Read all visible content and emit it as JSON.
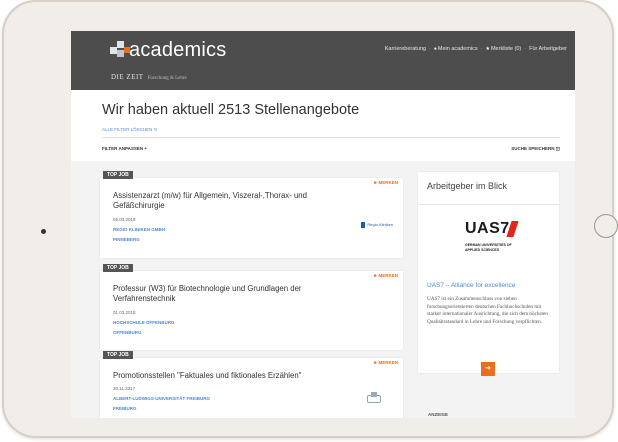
{
  "header": {
    "logo_text": "academics",
    "logo_sub_brand": "DIE ZEIT",
    "logo_sub_tagline": "Forschung & Lehre",
    "nav": {
      "karriereberatung": "Karriereberatung",
      "mein_academics": "Mein academics",
      "merkliste": "Merkliste (0)",
      "arbeitgeber": "Für Arbeitgeber"
    }
  },
  "page": {
    "title": "Wir haben aktuell 2513 Stellenangebote",
    "clear_filters": "ALLE FILTER LÖSCHEN",
    "adjust_filters": "FILTER ANPASSEN +",
    "save_search": "SUCHE SPEICHERN"
  },
  "jobs": [
    {
      "badge": "TOP JOB",
      "merken": "MERKEN",
      "title": "Assistenzarzt (m/w) für Allgemein, Viszeral-,Thorax- und Gefäßchirurgie",
      "date": "05.03.2018",
      "employer": "REGIO KLINIKEN GMBH",
      "city": "PINNEBERG",
      "logo_text": "Regio Kliniken"
    },
    {
      "badge": "TOP JOB",
      "merken": "MERKEN",
      "title": "Professur (W3) für Biotechnologie und Grundlagen der Verfahrenstechnik",
      "date": "01.03.2018",
      "employer": "HOCHSCHULE OFFENBURG",
      "city": "OFFENBURG"
    },
    {
      "badge": "TOP JOB",
      "merken": "MERKEN",
      "title": "Promotionsstellen \"Faktuales und fiktionales Erzählen\"",
      "date": "30.11.2017",
      "employer": "ALBERT-LUDWIGS-UNIVERSITÄT FREIBURG",
      "city": "FREIBURG"
    }
  ],
  "sidebar": {
    "title": "Arbeitgeber im Blick",
    "uas_logo": "UAS",
    "uas_logo_seven": "7",
    "uas_sub_1": "GERMAN UNIVERSITIES OF",
    "uas_sub_2": "APPLIED SCIENCES",
    "heading": "UAS7 – Alliance for excellence",
    "text": "UAS7 ist ein Zusammenschluss von sieben forschungsorientierten deutschen Fachhochschulen mit starker internationaler Ausrichtung, die sich dem höchsten Qualitätsstandard in Lehre und Forschung verpflichten.",
    "anzeige": "ANZEIGE"
  },
  "colors": {
    "header_bg": "#4d4d4d",
    "accent": "#eb6e1f",
    "link": "#4a8ad4",
    "uas_red": "#e2261a"
  }
}
